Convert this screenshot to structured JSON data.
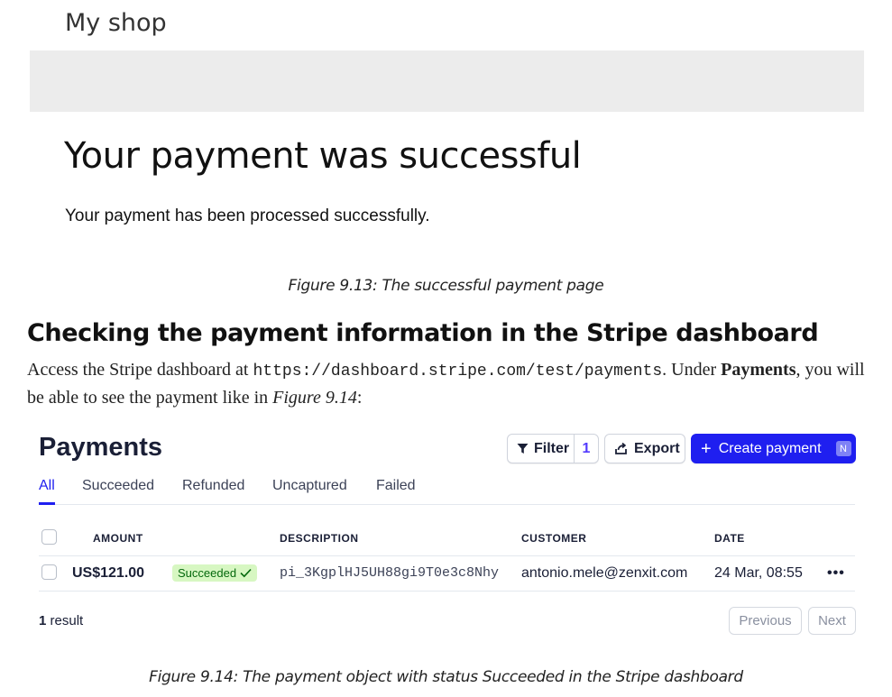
{
  "shop": {
    "title": "My shop",
    "heading": "Your payment was successful",
    "message": "Your payment has been processed successfully."
  },
  "captions": {
    "fig_9_13": "Figure 9.13: The successful payment page",
    "fig_9_14": "Figure 9.14: The payment object with status Succeeded in the Stripe dashboard"
  },
  "section": {
    "heading": "Checking the payment information in the Stripe dashboard",
    "para_part1": "Access the Stripe dashboard at ",
    "para_url": "https://dashboard.stripe.com/test/payments",
    "para_part2": ". Under ",
    "para_bold": "Payments",
    "para_part3": ", you will be able to see the payment like in ",
    "para_italic": "Figure 9.14",
    "para_part4": ":"
  },
  "stripe": {
    "title": "Payments",
    "filter_label": "Filter",
    "filter_count": "1",
    "export_label": "Export",
    "create_label": "Create payment",
    "create_shortcut": "N",
    "tabs": [
      "All",
      "Succeeded",
      "Refunded",
      "Uncaptured",
      "Failed"
    ],
    "active_tab": "All",
    "columns": {
      "amount": "AMOUNT",
      "description": "DESCRIPTION",
      "customer": "CUSTOMER",
      "date": "DATE"
    },
    "rows": [
      {
        "amount": "US$121.00",
        "status": "Succeeded",
        "status_color": "#d7f7c2",
        "description": "pi_3KgplHJ5UH88gi9T0e3c8Nhy",
        "customer": "antonio.mele@zenxit.com",
        "date": "24 Mar, 08:55",
        "more": "•••"
      }
    ],
    "result_count": "1",
    "result_label": " result",
    "prev_label": "Previous",
    "next_label": "Next",
    "accent_color": "#1f1ff0"
  },
  "icons": {
    "filter": "funnel-icon",
    "export": "export-icon",
    "create": "plus-icon",
    "status": "checkmark-icon",
    "more": "ellipsis-icon"
  }
}
